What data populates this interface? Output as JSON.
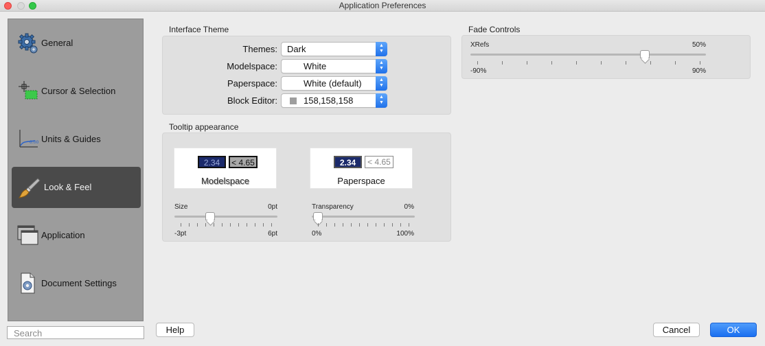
{
  "window": {
    "title": "Application Preferences"
  },
  "sidebar": {
    "items": [
      {
        "label": "General",
        "icon": "gear-icon"
      },
      {
        "label": "Cursor & Selection",
        "icon": "crosshair-selection-icon"
      },
      {
        "label": "Units & Guides",
        "icon": "axes-guides-icon"
      },
      {
        "label": "Look & Feel",
        "icon": "paintbrush-icon",
        "active": true
      },
      {
        "label": "Application",
        "icon": "application-windows-icon"
      },
      {
        "label": "Document Settings",
        "icon": "document-settings-icon"
      }
    ],
    "search_placeholder": "Search"
  },
  "interface_theme": {
    "title": "Interface Theme",
    "rows": [
      {
        "label": "Themes:",
        "value": "Dark"
      },
      {
        "label": "Modelspace:",
        "value": "White"
      },
      {
        "label": "Paperspace:",
        "value": "White (default)"
      },
      {
        "label": "Block Editor:",
        "value": "158,158,158",
        "swatch_color": "#9e9e9e"
      }
    ]
  },
  "tooltip": {
    "title": "Tooltip appearance",
    "modelspace": {
      "value_a": "2.34",
      "value_b": "< 4.65",
      "caption": "Modelspace"
    },
    "paperspace": {
      "value_a": "2.34",
      "value_b": "< 4.65",
      "caption": "Paperspace"
    },
    "size_slider": {
      "label": "Size",
      "current": "0pt",
      "min": "-3pt",
      "max": "6pt",
      "value_fraction": 0.333
    },
    "transparency_slider": {
      "label": "Transparency",
      "current": "0%",
      "min": "0%",
      "max": "100%",
      "value_fraction": 0.0
    }
  },
  "fade_controls": {
    "title": "Fade Controls",
    "xrefs": {
      "label": "XRefs",
      "current": "50%",
      "min": "-90%",
      "max": "90%",
      "value_fraction": 0.75
    }
  },
  "buttons": {
    "help": "Help",
    "cancel": "Cancel",
    "ok": "OK"
  },
  "colors": {
    "accent": "#1f71ea",
    "active_nav": "#4a4a4a",
    "tooltip_dark": "#1b2a6b"
  }
}
